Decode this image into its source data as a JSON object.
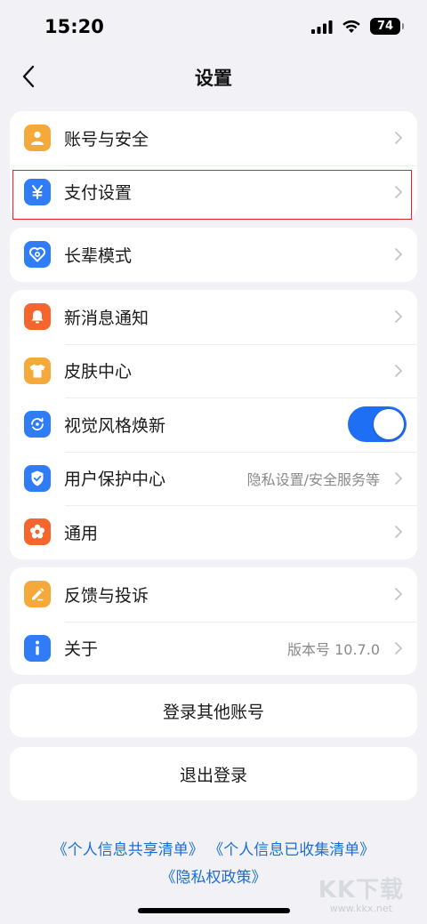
{
  "status": {
    "time": "15:20",
    "battery": "74"
  },
  "nav": {
    "title": "设置"
  },
  "group1": [
    {
      "label": "账号与安全",
      "icon": "person-icon",
      "color": "#f6a93b"
    },
    {
      "label": "支付设置",
      "icon": "yuan-icon",
      "color": "#2f7cf6"
    }
  ],
  "group2": [
    {
      "label": "长辈模式",
      "icon": "heart-icon",
      "color": "#2f7cf6"
    }
  ],
  "group3": [
    {
      "label": "新消息通知",
      "icon": "bell-icon",
      "color": "#f5652e"
    },
    {
      "label": "皮肤中心",
      "icon": "tshirt-icon",
      "color": "#f6a93b"
    },
    {
      "label": "视觉风格焕新",
      "icon": "refresh-icon",
      "color": "#2f7cf6",
      "toggle": true
    },
    {
      "label": "用户保护中心",
      "value": "隐私设置/安全服务等",
      "icon": "shield-icon",
      "color": "#2f7cf6"
    },
    {
      "label": "通用",
      "icon": "flower-icon",
      "color": "#f5652e"
    }
  ],
  "group4": [
    {
      "label": "反馈与投诉",
      "icon": "pencil-icon",
      "color": "#f6a93b"
    },
    {
      "label": "关于",
      "value": "版本号 10.7.0",
      "icon": "info-icon",
      "color": "#2f7cf6"
    }
  ],
  "buttons": {
    "switch_account": "登录其他账号",
    "logout": "退出登录"
  },
  "links": {
    "shared_list": "《个人信息共享清单》",
    "collected_list": "《个人信息已收集清单》",
    "privacy_policy": "《隐私权政策》"
  },
  "watermark": {
    "logo": "KK下载",
    "url": "www.kkx.net"
  }
}
